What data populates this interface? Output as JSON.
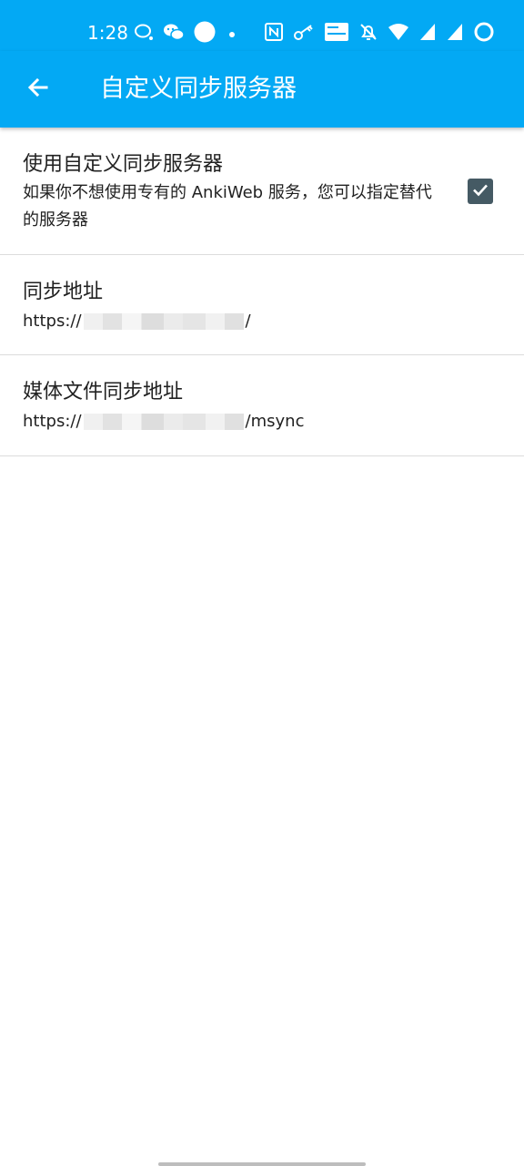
{
  "status_bar": {
    "time": "1:28",
    "left_icons": [
      "bubble-icon",
      "wechat-icon",
      "circle-icon",
      "dot-icon"
    ],
    "right_icons": [
      "nfc-icon",
      "key-icon",
      "volte-icon",
      "bell-off-icon",
      "wifi-icon",
      "signal-icon",
      "signal-icon-2",
      "battery-icon"
    ]
  },
  "toolbar": {
    "back_icon": "arrow-left-icon",
    "title": "自定义同步服务器"
  },
  "preferences": [
    {
      "title": "使用自定义同步服务器",
      "summary": "如果你不想使用专有的 AnkiWeb 服务，您可以指定替代的服务器",
      "checked": true
    },
    {
      "title": "同步地址",
      "summary_prefix": "https://",
      "summary_suffix": "/"
    },
    {
      "title": "媒体文件同步地址",
      "summary_prefix": "https://",
      "summary_suffix": "/msync"
    }
  ],
  "colors": {
    "accent": "#03a9f4",
    "checkbox": "#455a64",
    "text": "#212121",
    "divider": "#dcdcdc"
  }
}
